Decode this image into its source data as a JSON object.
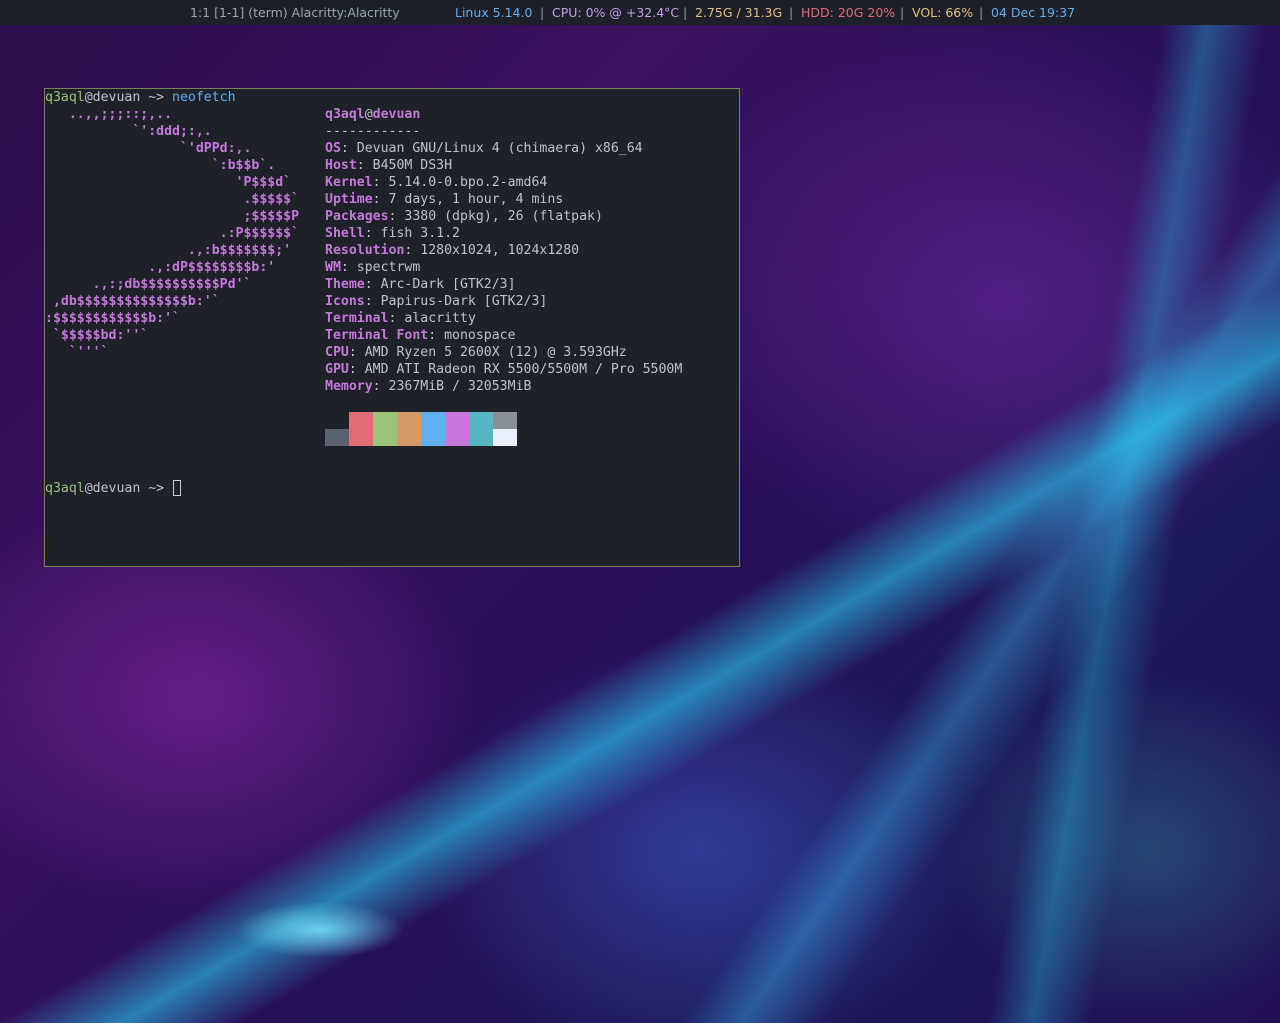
{
  "topbar": {
    "workspace": "1:1 [1-1] (term) Alacritty:Alacritty",
    "kernel": "Linux 5.14.0",
    "cpu": "CPU: 0% @ +32.4°C",
    "mem": "2.75G / 31.3G",
    "hdd": "HDD: 20G 20%",
    "vol": "VOL: 66%",
    "date": "04 Dec 19:37",
    "separator": "|",
    "colors": {
      "kernel": "#61afef",
      "cpu": "#c69fe8",
      "mem": "#e5c07b",
      "hdd": "#e06c75",
      "vol": "#e5c07b",
      "date": "#61afef"
    }
  },
  "terminal": {
    "prompt": {
      "user": "q3aql",
      "at_host": "@devuan",
      "arrow": " ~> ",
      "command": "neofetch"
    },
    "logo": [
      "   ..,,;;;::;,..",
      "           `':ddd;:,.",
      "                 `'dPPd:,.",
      "                     `:b$$b`.",
      "                        'P$$$d`",
      "                         .$$$$$`",
      "                         ;$$$$$P",
      "                      .:P$$$$$$`",
      "                  .,:b$$$$$$$;'",
      "             .,:dP$$$$$$$$b:'",
      "      .,:;db$$$$$$$$$$Pd'`",
      " ,db$$$$$$$$$$$$$$b:'`",
      ":$$$$$$$$$$$$b:'`",
      " `$$$$$bd:''`",
      "   `'''`"
    ],
    "title": {
      "user": "q3aql",
      "at": "@",
      "host": "devuan"
    },
    "underline": "------------",
    "info": [
      {
        "key": "OS",
        "value": "Devuan GNU/Linux 4 (chimaera) x86_64"
      },
      {
        "key": "Host",
        "value": "B450M DS3H"
      },
      {
        "key": "Kernel",
        "value": "5.14.0-0.bpo.2-amd64"
      },
      {
        "key": "Uptime",
        "value": "7 days, 1 hour, 4 mins"
      },
      {
        "key": "Packages",
        "value": "3380 (dpkg), 26 (flatpak)"
      },
      {
        "key": "Shell",
        "value": "fish 3.1.2"
      },
      {
        "key": "Resolution",
        "value": "1280x1024, 1024x1280"
      },
      {
        "key": "WM",
        "value": "spectrwm"
      },
      {
        "key": "Theme",
        "value": "Arc-Dark [GTK2/3]"
      },
      {
        "key": "Icons",
        "value": "Papirus-Dark [GTK2/3]"
      },
      {
        "key": "Terminal",
        "value": "alacritty"
      },
      {
        "key": "Terminal Font",
        "value": "monospace"
      },
      {
        "key": "CPU",
        "value": "AMD Ryzen 5 2600X (12) @ 3.593GHz"
      },
      {
        "key": "GPU",
        "value": "AMD ATI Radeon RX 5500/5500M / Pro 5500M"
      },
      {
        "key": "Memory",
        "value": "2367MiB / 32053MiB"
      }
    ],
    "key_sep": ": ",
    "palette_top": [
      "#1e2128",
      "#e06c75",
      "#98c379",
      "#d19a66",
      "#61afef",
      "#c678dd",
      "#56b6c2",
      "#8a8f99"
    ],
    "palette_bottom": [
      "#5c6370",
      "#e06c75",
      "#98c379",
      "#d19a66",
      "#61afef",
      "#c678dd",
      "#56b6c2",
      "#eaf0fb"
    ],
    "prompt2": {
      "user": "q3aql",
      "at_host": "@devuan",
      "arrow": " ~> "
    }
  }
}
